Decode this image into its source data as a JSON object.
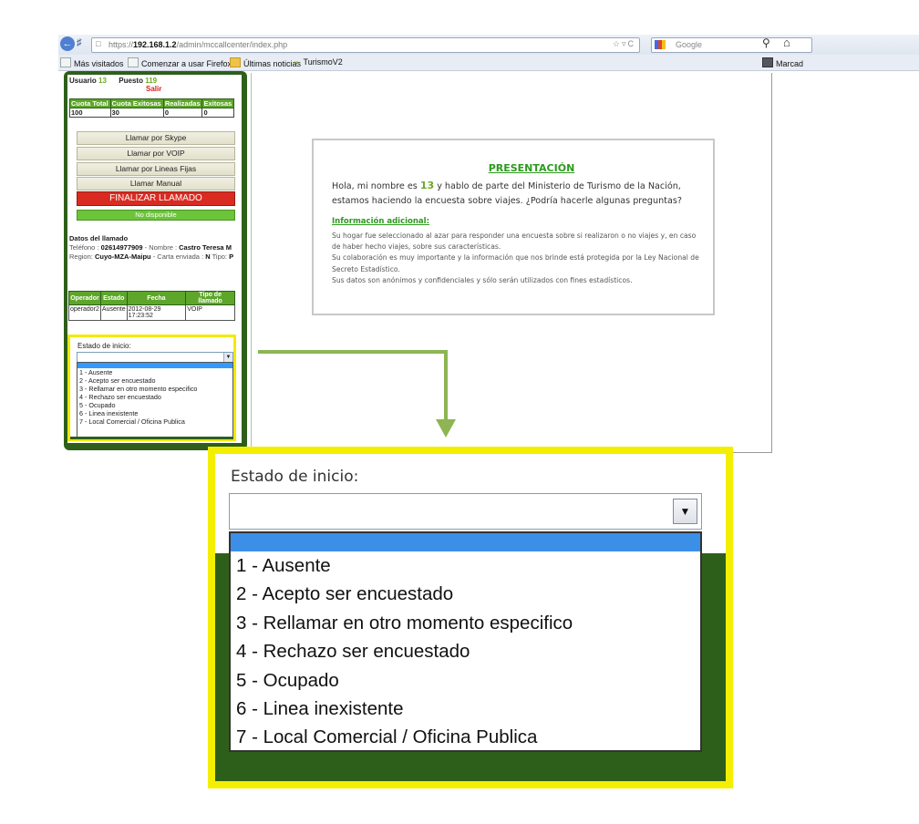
{
  "browser": {
    "url_prefix": "https://",
    "url_host": "192.168.1.2",
    "url_path": "/admin/mccallcenter/index.php",
    "search_placeholder": "Google",
    "bookmarks": [
      "Más visitados",
      "Comenzar a usar Firefox",
      "Últimas noticias",
      "TurismoV2"
    ],
    "bookmarks_right": "Marcad"
  },
  "sidebar": {
    "usuario_label": "Usuario",
    "usuario_value": "13",
    "puesto_label": "Puesto",
    "puesto_value": "119",
    "salir": "Salir",
    "quota_headers": [
      "Cuota Total",
      "Cuota Exitosas",
      "Realizadas",
      "Exitosas"
    ],
    "quota_values": [
      "100",
      "30",
      "0",
      "0"
    ],
    "buttons": {
      "skype": "Llamar por Skype",
      "voip": "Llamar por VOIP",
      "fijas": "Llamar por Lineas Fijas",
      "manual": "Llamar Manual",
      "finalizar": "FINALIZAR LLAMADO",
      "status": "No disponible"
    },
    "datos": {
      "title": "Datos del llamado",
      "telefono_label": "Teléfono :",
      "telefono": "02614977909",
      "nombre_label": "- Nombre :",
      "nombre": "Castro Teresa M",
      "region_label": "Region:",
      "region": "Cuyo-MZA-Maipu",
      "carta_label": "- Carta enviada :",
      "carta": "N",
      "tipo_label": "Tipo:",
      "tipo": "P"
    },
    "ops_headers": [
      "Operador",
      "Estado",
      "Fecha",
      "Tipo de llamado"
    ],
    "ops_row": [
      "operador2",
      "Ausente",
      "2012-08-29 17:23:52",
      "VOIP"
    ],
    "estado_label": "Estado de inicio:"
  },
  "estado_options": [
    "1 - Ausente",
    "2 - Acepto ser encuestado",
    "3 - Rellamar en otro momento especifico",
    "4 - Rechazo ser encuestado",
    "5 - Ocupado",
    "6 - Linea inexistente",
    "7 - Local Comercial / Oficina Publica"
  ],
  "presentacion": {
    "title": "PRESENTACIÓN",
    "text_before": "Hola, mi nombre es",
    "number": "13",
    "text_after": "y hablo de parte del Ministerio de Turismo de la Nación, estamos haciendo la encuesta sobre viajes. ¿Podría hacerle algunas preguntas?",
    "info_title": "Información adicional:",
    "info_lines": [
      "Su hogar fue seleccionado al azar para responder una encuesta sobre si realizaron o no viajes y, en caso de haber hecho viajes, sobre sus características.",
      "Su colaboración es muy importante y la información que nos brinde está protegida por la Ley Nacional de Secreto Estadístico.",
      "Sus datos son anónimos y confidenciales y sólo serán utilizados con fines estadísticos."
    ]
  },
  "colors": {
    "brand_green": "#2e5f1a",
    "accent_green": "#6aaa22",
    "highlight_yellow": "#f4ef00",
    "end_call_red": "#d92b21",
    "connector": "#8db553"
  }
}
